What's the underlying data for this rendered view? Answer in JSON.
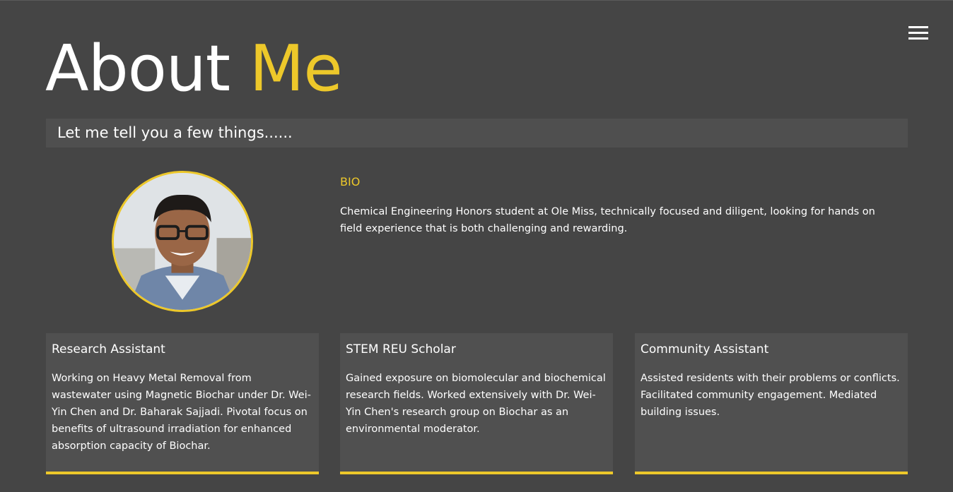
{
  "header": {
    "menu_icon": "hamburger-menu-icon",
    "title_part1": "About",
    "title_part2": "Me",
    "accent_color": "#edc82a"
  },
  "tagline": "Let me tell you a few things......",
  "bio": {
    "heading": "BIO",
    "text": "Chemical Engineering Honors student at Ole Miss, technically focused and diligent, looking for hands on field experience that is both challenging and rewarding."
  },
  "cards": [
    {
      "title": "Research Assistant",
      "text": "Working on Heavy Metal Removal from wastewater using Magnetic Biochar under Dr. Wei-Yin Chen and Dr. Baharak Sajjadi. Pivotal focus on benefits of ultrasound irradiation for enhanced absorption capacity of Biochar."
    },
    {
      "title": "STEM REU Scholar",
      "text": "Gained exposure on biomolecular and biochemical research fields. Worked extensively with Dr. Wei-Yin Chen's research group on Biochar as an environmental moderator."
    },
    {
      "title": "Community Assistant",
      "text": "Assisted residents with their problems or conflicts. Facilitated community engagement. Mediated building issues."
    }
  ]
}
